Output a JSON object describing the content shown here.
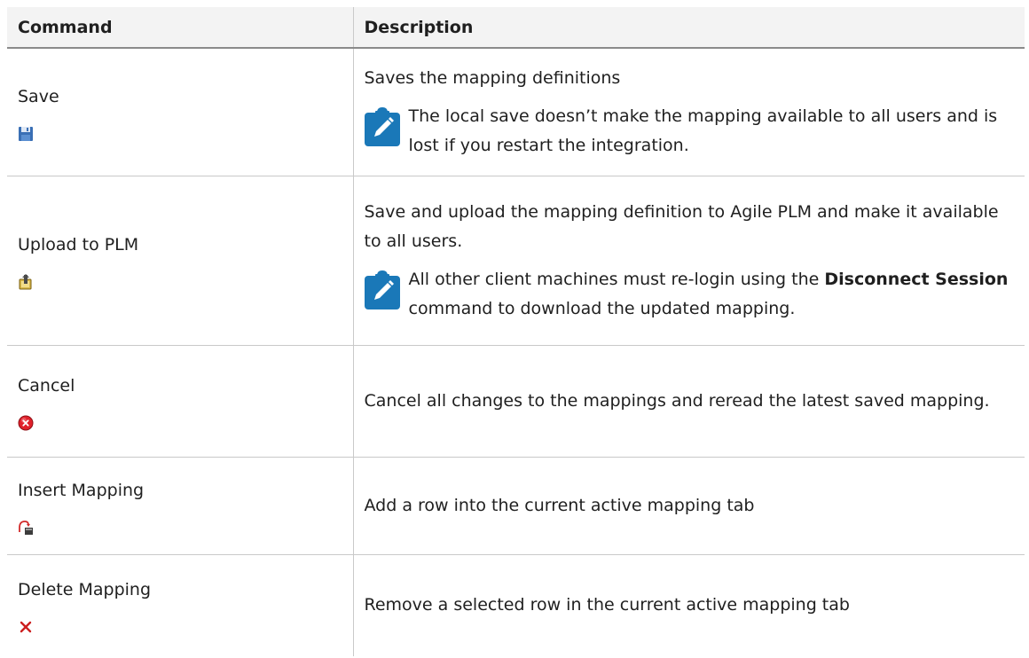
{
  "table": {
    "headers": {
      "command": "Command",
      "description": "Description"
    },
    "rows": [
      {
        "command": "Save",
        "icon": "save-floppy-icon",
        "description": "Saves the mapping definitions",
        "note": "The local save doesn’t make the mapping available to all users and is lost if you restart the integration."
      },
      {
        "command": "Upload to PLM",
        "icon": "upload-plm-icon",
        "description": "Save and upload the mapping definition to Agile PLM and make it available to all users.",
        "note_pre": "All other client machines must re-login using the ",
        "note_bold": "Disconnect Session",
        "note_post": " command to download the updated mapping."
      },
      {
        "command": "Cancel",
        "icon": "cancel-icon",
        "description": "Cancel all changes to the mappings and reread the latest saved mapping."
      },
      {
        "command": "Insert Mapping",
        "icon": "insert-mapping-icon",
        "description": "Add a row into the current active mapping tab"
      },
      {
        "command": "Delete Mapping",
        "icon": "delete-icon",
        "description": "Remove a selected row in the current active mapping tab"
      }
    ]
  },
  "colors": {
    "header_bg": "#f3f3f3",
    "note_blue": "#1a78b8",
    "border": "#c9c9c9"
  }
}
